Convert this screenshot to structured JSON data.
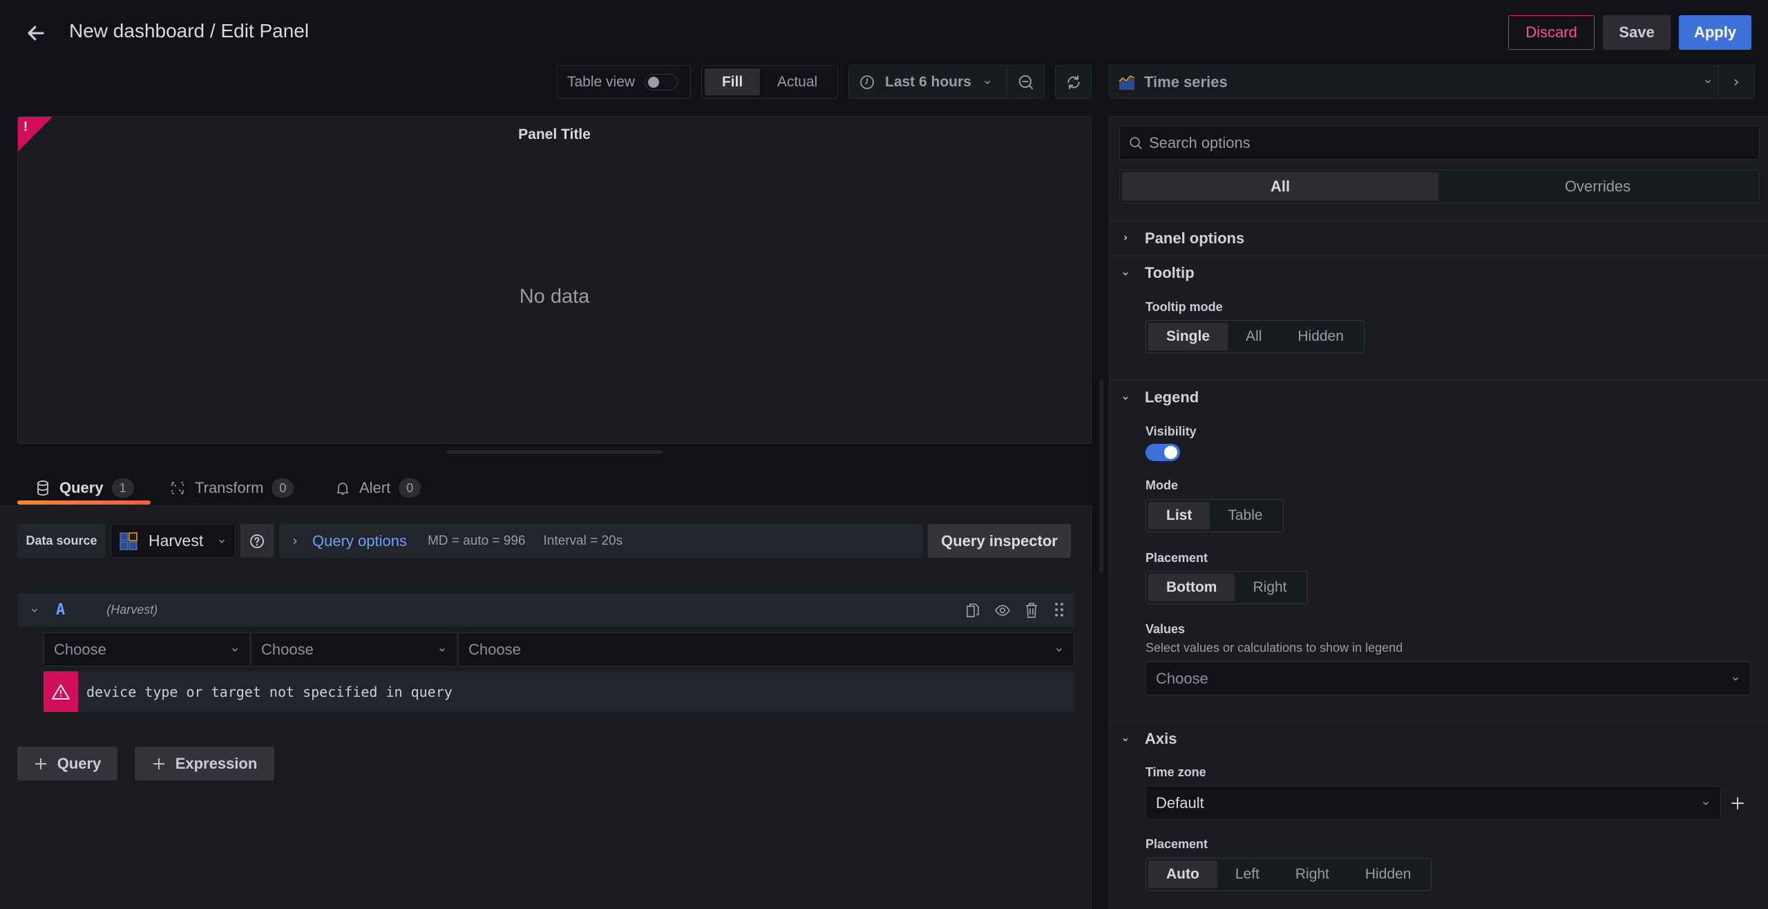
{
  "header": {
    "title": "New dashboard / Edit Panel",
    "discard_label": "Discard",
    "save_label": "Save",
    "apply_label": "Apply"
  },
  "toolbar": {
    "table_view_label": "Table view",
    "table_view_on": false,
    "fill_label": "Fill",
    "actual_label": "Actual",
    "fill_mode_selected": "Fill",
    "time_range_label": "Last 6 hours"
  },
  "panel": {
    "title": "Panel Title",
    "empty_message": "No data",
    "error_indicator": "!"
  },
  "tabs": [
    {
      "label": "Query",
      "count": "1",
      "active": true
    },
    {
      "label": "Transform",
      "count": "0",
      "active": false
    },
    {
      "label": "Alert",
      "count": "0",
      "active": false
    }
  ],
  "query_editor": {
    "data_source_label": "Data source",
    "data_source_value": "Harvest",
    "query_options_label": "Query options",
    "max_data_points": "MD = auto = 996",
    "interval": "Interval = 20s",
    "query_inspector_label": "Query inspector",
    "query": {
      "ref_id": "A",
      "datasource_hint": "(Harvest)",
      "selects": [
        {
          "placeholder": "Choose"
        },
        {
          "placeholder": "Choose"
        },
        {
          "placeholder": "Choose"
        }
      ],
      "error_message": "device type or target not specified in query"
    },
    "add_query_label": "Query",
    "add_expression_label": "Expression"
  },
  "options_pane": {
    "visualization": "Time series",
    "search_placeholder": "Search options",
    "tabs": [
      {
        "label": "All",
        "active": true
      },
      {
        "label": "Overrides",
        "active": false
      }
    ],
    "sections": {
      "panel_options": {
        "title": "Panel options",
        "expanded": false
      },
      "tooltip": {
        "title": "Tooltip",
        "expanded": true,
        "mode_label": "Tooltip mode",
        "mode_options": [
          "Single",
          "All",
          "Hidden"
        ],
        "mode_selected": "Single"
      },
      "legend": {
        "title": "Legend",
        "expanded": true,
        "visibility_label": "Visibility",
        "visibility_on": true,
        "mode_label": "Mode",
        "mode_options": [
          "List",
          "Table"
        ],
        "mode_selected": "List",
        "placement_label": "Placement",
        "placement_options": [
          "Bottom",
          "Right"
        ],
        "placement_selected": "Bottom",
        "values_label": "Values",
        "values_description": "Select values or calculations to show in legend",
        "values_placeholder": "Choose"
      },
      "axis": {
        "title": "Axis",
        "expanded": true,
        "timezone_label": "Time zone",
        "timezone_value": "Default",
        "placement_label": "Placement",
        "placement_options": [
          "Auto",
          "Left",
          "Right",
          "Hidden"
        ],
        "placement_selected": "Auto"
      }
    }
  },
  "colors": {
    "background": "#111217",
    "panel": "#181b1f",
    "primary": "#3d71d9",
    "danger": "#e0226e",
    "discard_text": "#ff5286",
    "link": "#6e9fff",
    "tab_underline": "#f55f3e"
  }
}
